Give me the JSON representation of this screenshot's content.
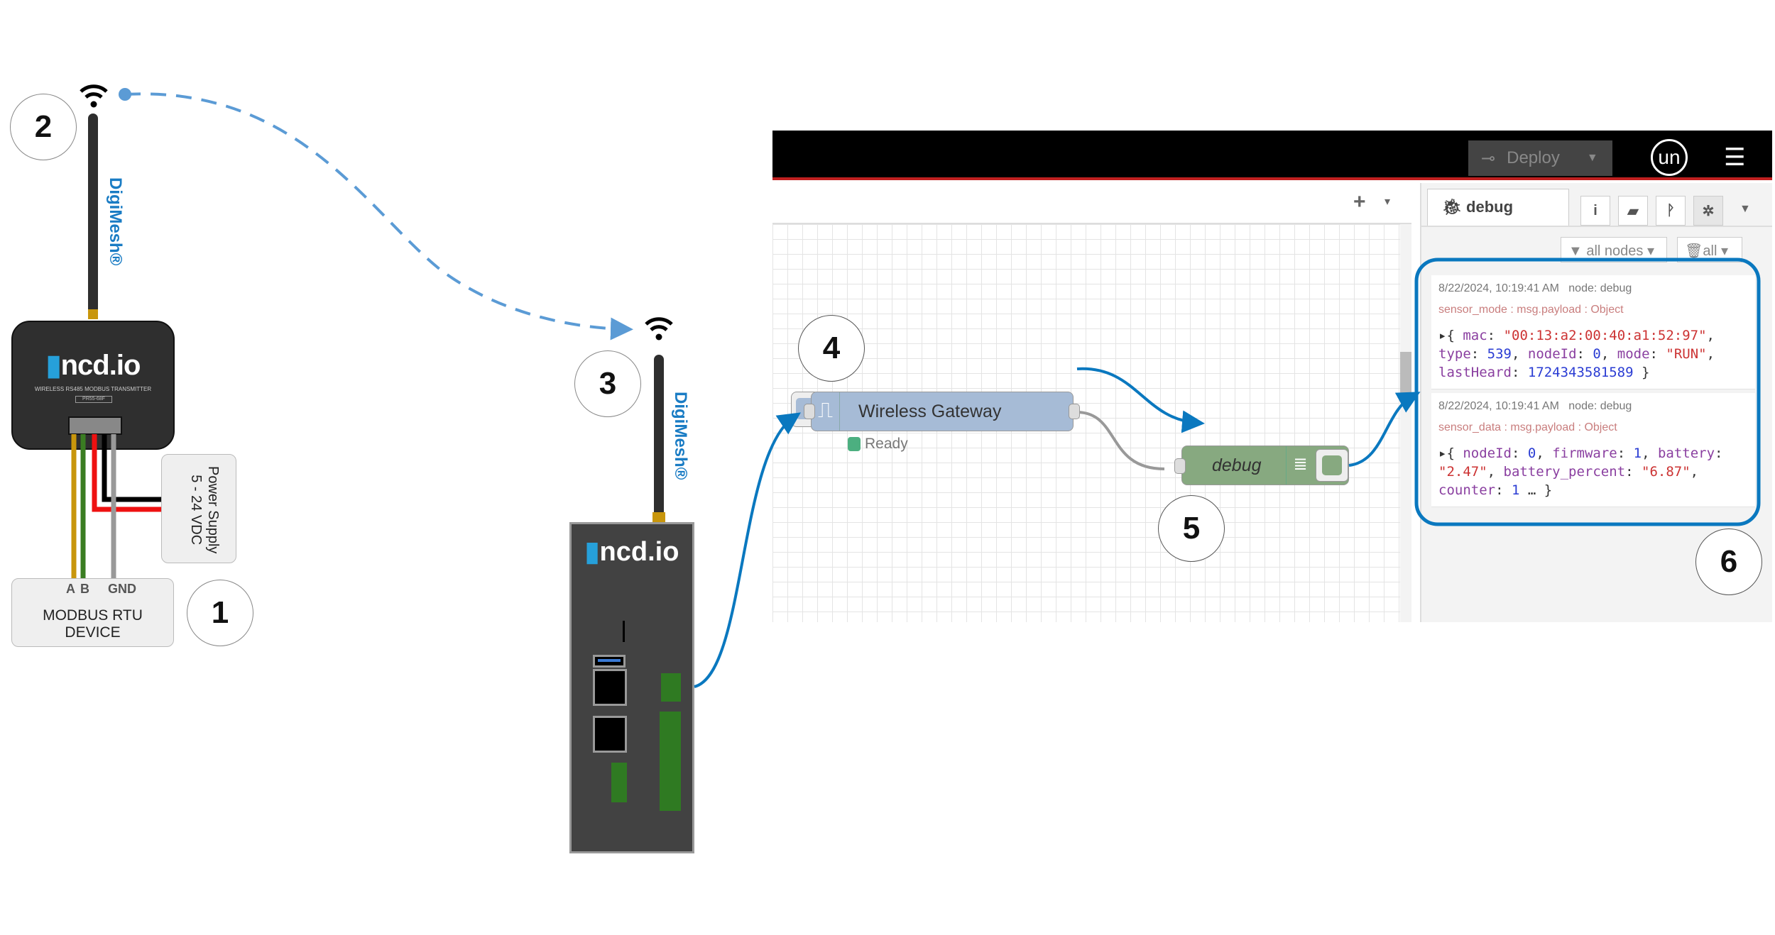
{
  "labels": {
    "n1": "1",
    "n2": "2",
    "n3": "3",
    "n4": "4",
    "n5": "5",
    "n6": "6"
  },
  "digimesh": "DigiMesh®",
  "sensor": {
    "brand": "ncd.io",
    "subtitle": "WIRELESS RS485 MODBUS TRANSMITTER",
    "model": "PR55-68F"
  },
  "power_supply": {
    "line1": "Power Supply",
    "line2": "5 - 24 VDC"
  },
  "modbus_device": {
    "pins": [
      "A",
      "B",
      "GND"
    ],
    "line1": "MODBUS RTU",
    "line2": "DEVICE"
  },
  "gateway": {
    "brand": "ncd.io"
  },
  "wire_colors": [
    "#c8960c",
    "#3a7d22",
    "#ee1111",
    "#000000",
    "#999999"
  ],
  "accent": "#0a78bf",
  "nodered": {
    "header": {
      "deploy_label": "Deploy",
      "user_initials": "un"
    },
    "workspace": {
      "add_icon": "+",
      "menu_icon": "▾"
    },
    "nodes": {
      "gateway": {
        "label": "Wireless Gateway",
        "status": "Ready",
        "status_color": "#4caf80"
      },
      "debug": {
        "label": "debug"
      }
    },
    "sidebar": {
      "tab_label": "debug",
      "filter_label": "all nodes",
      "clear_label": "all",
      "messages": [
        {
          "timestamp": "8/22/2024, 10:19:41 AM",
          "node": "node: debug",
          "topic": "sensor_mode : msg.payload : Object"
        },
        {
          "timestamp": "8/22/2024, 10:19:41 AM",
          "node": "node: debug",
          "topic": "sensor_data : msg.payload : Object"
        }
      ],
      "payload1": {
        "mac": "\"00:13:a2:00:40:a1:52:97\"",
        "type": "539",
        "nodeId": "0",
        "mode": "\"RUN\"",
        "lastHeard": "1724343581589"
      },
      "payload2": {
        "nodeId": "0",
        "firmware": "1",
        "battery": "\"2.47\"",
        "battery_percent": "\"6.87\"",
        "counter": "1"
      }
    }
  }
}
